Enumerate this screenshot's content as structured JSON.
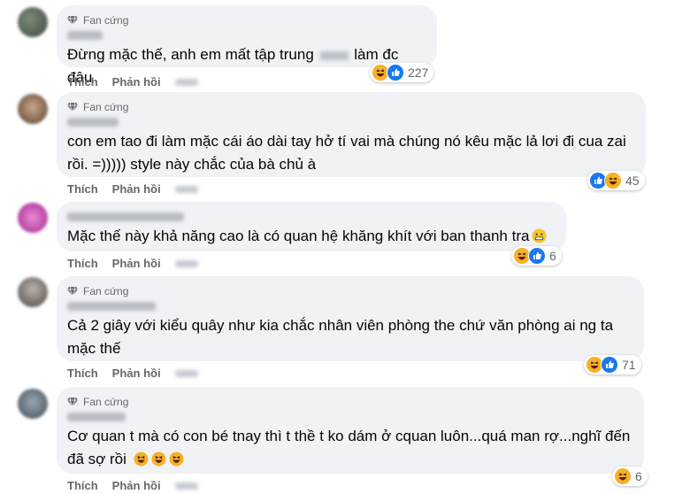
{
  "colors": {
    "bubble": "#f0f2f5",
    "secondary_text": "#65676b",
    "like_blue": "#1877f2",
    "haha_yellow": "#f7b125"
  },
  "comments": [
    {
      "badge": "Fan cứng",
      "text_before": "Đừng mặc thế, anh em mất tập trung",
      "text_after": "làm đc đâu",
      "reactions": [
        "haha-icon",
        "like-icon"
      ],
      "count": "227",
      "like_label": "Thích",
      "reply_label": "Phản hồi"
    },
    {
      "badge": "Fan cứng",
      "text": "con em tao đi làm mặc cái áo dài tay hở tí vai mà chúng nó kêu mặc lả lơi đi cua zai rồi. =))))) style này chắc của bà chủ à",
      "reactions": [
        "like-icon",
        "haha-icon"
      ],
      "count": "45",
      "like_label": "Thích",
      "reply_label": "Phản hồi"
    },
    {
      "badge": "",
      "text": "Mặc thế này khả năng cao là có quan hệ khăng khít với ban thanh tra",
      "reactions": [
        "haha-icon",
        "like-icon"
      ],
      "count": "6",
      "like_label": "Thích",
      "reply_label": "Phản hồi"
    },
    {
      "badge": "Fan cứng",
      "text": "Cả 2 giây với kiểu quây như kia chắc nhân viên phòng the chứ văn phòng ai ng ta mặc thế",
      "reactions": [
        "haha-icon",
        "like-icon"
      ],
      "count": "71",
      "like_label": "Thích",
      "reply_label": "Phản hồi"
    },
    {
      "badge": "Fan cứng",
      "text": "Cơ quan t mà có con bé tnay thì t thề t ko dám ở cquan luôn...quá man rợ...nghĩ đến đã sợ rồi",
      "reactions": [
        "haha-icon"
      ],
      "count": "6",
      "like_label": "Thích",
      "reply_label": "Phản hồi"
    }
  ]
}
